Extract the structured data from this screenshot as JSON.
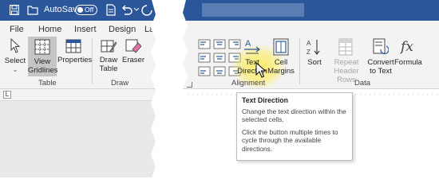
{
  "qat": {
    "autosave_label": "AutoSave",
    "autosave_state": "Off"
  },
  "tabs": [
    "File",
    "Home",
    "Insert",
    "Design",
    "Lay"
  ],
  "left_ribbon": {
    "select": "Select",
    "view_gridlines": [
      "View",
      "Gridlines"
    ],
    "properties": "Properties",
    "draw_table": [
      "Draw",
      "Table"
    ],
    "eraser": "Eraser",
    "group_table": "Table",
    "group_draw": "Draw"
  },
  "right_ribbon": {
    "text_direction": [
      "Text",
      "Direction"
    ],
    "cell_margins": [
      "Cell",
      "Margins"
    ],
    "sort": "Sort",
    "repeat_header_rows": [
      "Repeat",
      "Header Rows"
    ],
    "convert_to_text": [
      "Convert",
      "to Text"
    ],
    "formula": "Formula",
    "group_alignment": "Alignment",
    "group_data": "Data"
  },
  "tooltip": {
    "title": "Text Direction",
    "line1": "Change the text direction within the selected cells.",
    "line2": "Click the button multiple times to cycle through the available directions."
  },
  "colors": {
    "title_bar": "#2b579a",
    "ribbon": "#f3f3f3",
    "highlight": "#ffec50",
    "selected_button": "#c5c5c5"
  }
}
